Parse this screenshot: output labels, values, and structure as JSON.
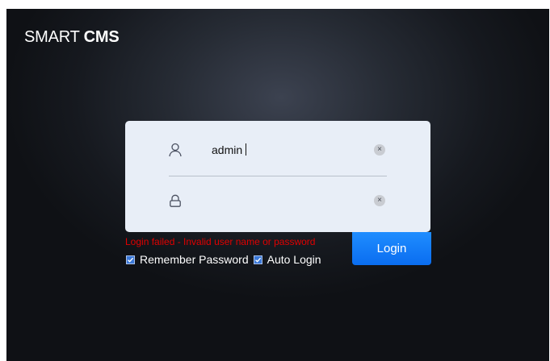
{
  "brand": {
    "prefix": "SMART ",
    "suffix": "CMS"
  },
  "login_form": {
    "username": {
      "icon": "user-icon",
      "value": "admin"
    },
    "password": {
      "icon": "lock-icon",
      "value": ""
    },
    "clear_glyph": "×",
    "error_message": "Login failed - Invalid user name or password",
    "remember_password": {
      "label": "Remember Password",
      "checked": true
    },
    "auto_login": {
      "label": "Auto Login",
      "checked": true
    },
    "login_button_label": "Login"
  },
  "colors": {
    "accent": "#0a7cff",
    "error": "#e10000",
    "card": "#e8eef7"
  }
}
